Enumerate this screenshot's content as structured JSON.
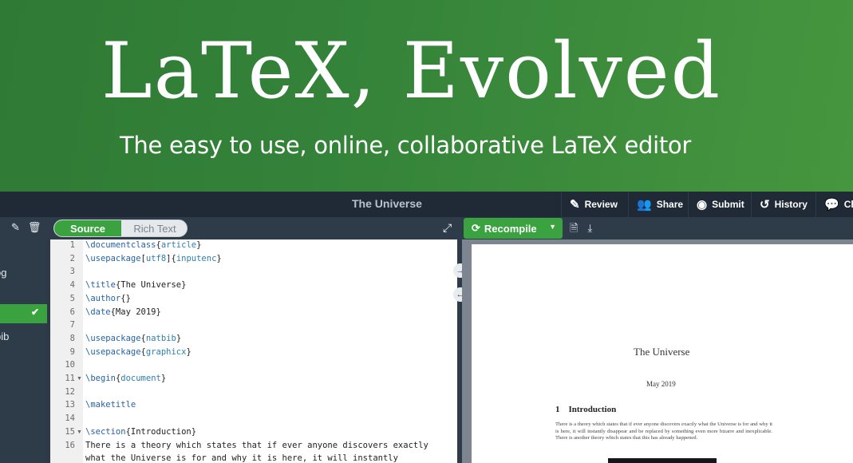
{
  "hero": {
    "title": "LaTeX, Evolved",
    "subtitle": "The easy to use, online, collaborative LaTeX editor"
  },
  "toolbar": {
    "document_title": "The Universe",
    "buttons": [
      {
        "label": "Review",
        "icon": "review-icon"
      },
      {
        "label": "Share",
        "icon": "users-icon"
      },
      {
        "label": "Submit",
        "icon": "globe-icon"
      },
      {
        "label": "History",
        "icon": "history-icon"
      },
      {
        "label": "Ch",
        "icon": "chat-icon"
      }
    ]
  },
  "editor_mode": {
    "source": "Source",
    "rich_text": "Rich Text",
    "active": "Source"
  },
  "recompile": {
    "label": "Recompile"
  },
  "file_tree": {
    "items": [
      {
        "label": "og",
        "selected": false
      },
      {
        "label": "",
        "selected": true
      },
      {
        "label": "bib",
        "selected": false
      }
    ]
  },
  "code_lines": [
    {
      "n": "1",
      "text": "\\documentclass{article}"
    },
    {
      "n": "2",
      "text": "\\usepackage[utf8]{inputenc}"
    },
    {
      "n": "3",
      "text": ""
    },
    {
      "n": "4",
      "text": "\\title{The Universe}"
    },
    {
      "n": "5",
      "text": "\\author{}"
    },
    {
      "n": "6",
      "text": "\\date{May 2019}"
    },
    {
      "n": "7",
      "text": ""
    },
    {
      "n": "8",
      "text": "\\usepackage{natbib}"
    },
    {
      "n": "9",
      "text": "\\usepackage{graphicx}"
    },
    {
      "n": "10",
      "text": ""
    },
    {
      "n": "11",
      "text": "\\begin{document}"
    },
    {
      "n": "12",
      "text": ""
    },
    {
      "n": "13",
      "text": "\\maketitle"
    },
    {
      "n": "14",
      "text": ""
    },
    {
      "n": "15",
      "text": "\\section{Introduction}"
    },
    {
      "n": "16",
      "text": "There is a theory which states that if ever anyone discovers exactly"
    },
    {
      "n": "",
      "text": "what the Universe is for and why it is here, it will instantly"
    }
  ],
  "pdf": {
    "title": "The Universe",
    "date": "May 2019",
    "section_number": "1",
    "section_title": "Introduction",
    "body": "There is a theory which states that if ever anyone discovers exactly what the Universe is for and why it is here, it will instantly disappear and be replaced by something even more bizarre and inexplicable. There is another theory which states that this has already happened."
  }
}
